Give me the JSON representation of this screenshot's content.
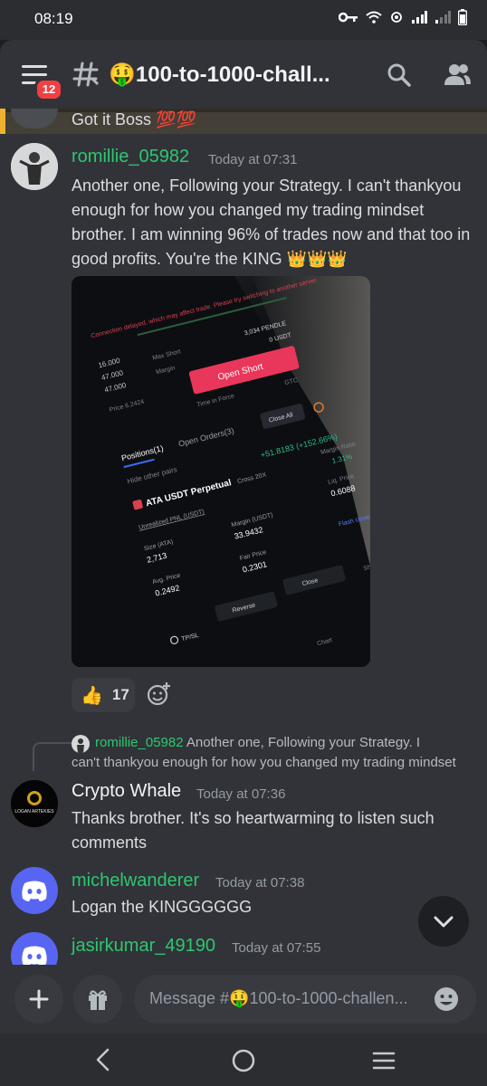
{
  "status_bar": {
    "time": "08:19"
  },
  "header": {
    "badge_count": "12",
    "channel_name": "🤑100-to-1000-chall..."
  },
  "messages": {
    "stub_text": "Got it Boss 💯💯",
    "msg1": {
      "username": "romillie_05982",
      "username_color": "#2dc770",
      "timestamp": "Today at 07:31",
      "lines": [
        "Another one, Following your Strategy. I can't thankyou",
        "enough for how you changed my trading mindset",
        "brother. I am winning 96% of trades now and that too in",
        "good profits. You're the KING 👑👑👑"
      ],
      "reaction_emoji": "👍",
      "reaction_count": "17"
    },
    "screenshot_text": {
      "connection_warning": "Connection delayed, which may affect trade. Please try switching to another server.",
      "open_short": "Open Short",
      "max_short": "Max Short",
      "margin": "Margin",
      "pendle": "3,034 PENDLE",
      "usdt_zero": "0 USDT",
      "vals": [
        "16.000",
        "47.000",
        "47.000"
      ],
      "price": "Price 6.2424",
      "time_in_force": "Time in Force",
      "gtc": "GTC",
      "positions": "Positions(1)",
      "open_orders": "Open Orders(3)",
      "hide_other_pairs": "Hide other pairs",
      "close_all": "Close All",
      "pair": "ATA USDT Perpetual",
      "cross": "Cross 20X",
      "pnl_label": "Unrealized PNL (USDT)",
      "pnl_value": "+51.8183 (+152.66%)",
      "margin_ratio_label": "Margin Ratio",
      "margin_ratio": "1.31%",
      "size_label": "Size (ATA)",
      "size": "2,713",
      "margin_usdt_label": "Margin (USDT)",
      "margin_usdt": "33.9432",
      "liq_price_label": "Liq. Price",
      "liq_price": "0.6088",
      "avg_price_label": "Avg. Price",
      "avg_price": "0.2492",
      "fair_price_label": "Fair Price",
      "fair_price": "0.2301",
      "flash_close": "Flash close",
      "close": "Close",
      "reverse": "Reverse",
      "tpsl": "TP/SL",
      "show": "Show",
      "chart": "Chart"
    },
    "reply_preview": {
      "username": "romillie_05982",
      "line1": "Another one, Following your Strategy. I",
      "line2": "can't thankyou enough for how you changed my trading mindset"
    },
    "msg2": {
      "username": "Crypto Whale",
      "timestamp": "Today at 07:36",
      "avatar_text": "LOGAN ARTEKIES",
      "lines": [
        "Thanks brother. It's so heartwarming to listen such",
        "comments"
      ]
    },
    "msg3": {
      "username": "michelwanderer",
      "username_color": "#2dc770",
      "timestamp": "Today at 07:38",
      "text": "Logan the KINGGGGGG"
    },
    "msg4": {
      "username": "jasirkumar_49190",
      "username_color": "#2dc770",
      "timestamp": "Today at 07:55"
    }
  },
  "composer": {
    "placeholder": "Message #🤑100-to-1000-challen..."
  },
  "colors": {
    "background": "#313338",
    "accent_blurple": "#5865f2",
    "online_green": "#2dc770",
    "badge_red": "#f23f42"
  }
}
